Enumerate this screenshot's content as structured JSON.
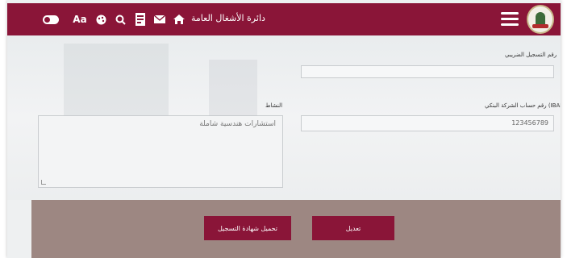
{
  "header": {
    "department_title": "دائرة الأشغال العامة",
    "accessibility_text_label": "Aa",
    "colors": {
      "bar": "#8a1538"
    }
  },
  "form": {
    "tax_number": {
      "label": "رقم التسجيل الضريبي",
      "value": ""
    },
    "iban": {
      "label": "رقم حساب الشركة البنكي (IBAN)",
      "value": "123456789"
    },
    "activity": {
      "label": "النشاط",
      "value": "استشارات هندسية شاملة"
    }
  },
  "footer": {
    "edit_label": "تعديل",
    "download_label": "تحميل شهادة التسجيل",
    "colors": {
      "band": "#9d8782",
      "button": "#8a1538"
    }
  }
}
